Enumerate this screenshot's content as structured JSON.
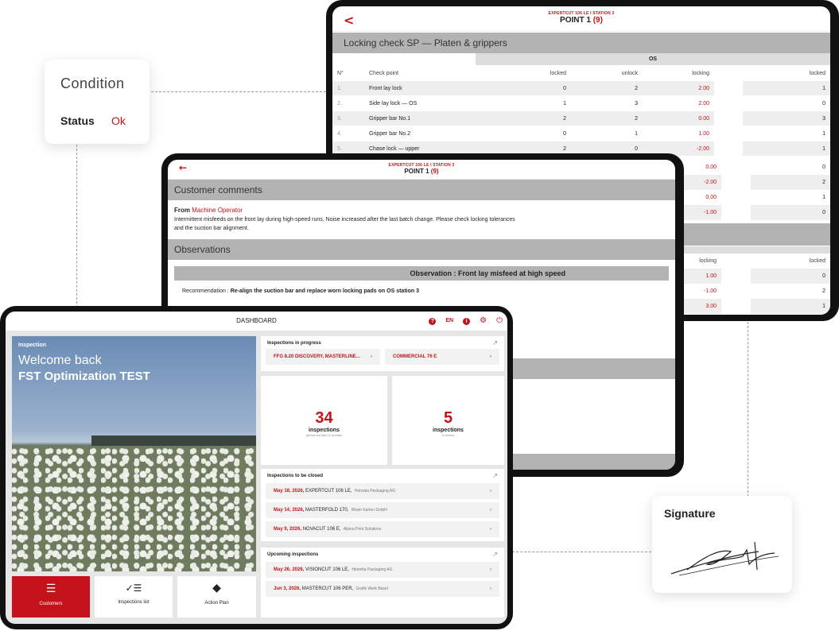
{
  "condition": {
    "title": "Condition",
    "status_label": "Status",
    "status_value": "Ok"
  },
  "signature": {
    "title": "Signature"
  },
  "back_tablet": {
    "subtitle": "EXPERTCUT 106 LE I STATION 3",
    "point": "POINT 1",
    "point_count": "(9)",
    "section": "Locking check SP — Platen & grippers",
    "group": "OS",
    "columns": [
      "N°",
      "Check point",
      "locked",
      "unlock",
      "locking",
      "locked"
    ],
    "rows": [
      {
        "n": "1.",
        "name": "Front lay lock",
        "locked": "0",
        "unlock": "2",
        "locking": "2.00",
        "locked2": "1"
      },
      {
        "n": "2.",
        "name": "Side lay lock — OS",
        "locked": "1",
        "unlock": "3",
        "locking": "2.00",
        "locked2": "0"
      },
      {
        "n": "3.",
        "name": "Gripper bar No.1",
        "locked": "2",
        "unlock": "2",
        "locking": "0.00",
        "locked2": "3"
      },
      {
        "n": "4.",
        "name": "Gripper bar No.2",
        "locked": "0",
        "unlock": "1",
        "locking": "1.00",
        "locked2": "1"
      },
      {
        "n": "5.",
        "name": "Chase lock — upper",
        "locked": "2",
        "unlock": "0",
        "locking": "-2.00",
        "locked2": "1"
      }
    ],
    "extra_rows": [
      {
        "locking": "0.00",
        "locked2": "0"
      },
      {
        "locking": "-2.00",
        "locked2": "2"
      },
      {
        "locking": "0.00",
        "locked2": "1"
      },
      {
        "locking": "-1.00",
        "locked2": "0"
      }
    ],
    "sec2_columns": [
      "locking",
      "locked"
    ],
    "sec2_rows": [
      {
        "locking": "1.00",
        "locked2": "0"
      },
      {
        "locking": "-1.00",
        "locked2": "2"
      },
      {
        "locking": "3.00",
        "locked2": "1"
      }
    ]
  },
  "mid_tablet": {
    "subtitle": "EXPERTCUT 106 LE I STATION 3",
    "point": "POINT 1",
    "point_count": "(9)",
    "comments_title": "Customer comments",
    "from_label": "From",
    "from_value": "Machine Operator",
    "comment": "Intermittent misfeeds on the front lay during high-speed runs. Noise increased after the last batch change. Please check locking tolerances and the suction bar alignment.",
    "observations_title": "Observations",
    "observation_heading": "Observation : Front lay misfeed at high speed",
    "recommendation_label": "Recommendation :",
    "recommendation": "Re-align the suction bar and replace worn locking pads on OS station 3"
  },
  "dashboard": {
    "title": "DASHBOARD",
    "lang": "EN",
    "hero": {
      "label": "Inspection",
      "welcome": "Welcome back",
      "user": "FST Optimization TEST"
    },
    "tiles": [
      {
        "label": "Customers",
        "icon": "list-icon"
      },
      {
        "label": "Inspections list",
        "icon": "checklist-icon"
      },
      {
        "label": "Action Plan",
        "icon": "layers-icon"
      }
    ],
    "in_progress": {
      "title": "Inspections in progress",
      "items": [
        "FFG 8.20 DISCOVERY, MASTERLINE...",
        "COMMERCIAL 76 E"
      ]
    },
    "stats": [
      {
        "value": "34",
        "label": "inspections",
        "sub": "performed last 12 months"
      },
      {
        "value": "5",
        "label": "inspections",
        "sub": "in review"
      }
    ],
    "to_close": {
      "title": "Inspections to be closed",
      "items": [
        {
          "date": "May 18, 2026,",
          "machine": "EXPERTCUT 106 LE,",
          "customer": "Helvetia Packaging AG"
        },
        {
          "date": "May 14, 2026,",
          "machine": "MASTERFOLD 170,",
          "customer": "Rhein Karton GmbH"
        },
        {
          "date": "May 9, 2026,",
          "machine": "NOVACUT 106 E,",
          "customer": "Alpina Print Solutions"
        }
      ]
    },
    "upcoming": {
      "title": "Upcoming inspections",
      "items": [
        {
          "date": "May 26, 2026,",
          "machine": "VISIONCUT 106 LE,",
          "customer": "Helvetia Packaging AG"
        },
        {
          "date": "Jun 3, 2026,",
          "machine": "MASTERCUT 106 PER,",
          "customer": "Grafik Werk Basel"
        }
      ]
    }
  }
}
